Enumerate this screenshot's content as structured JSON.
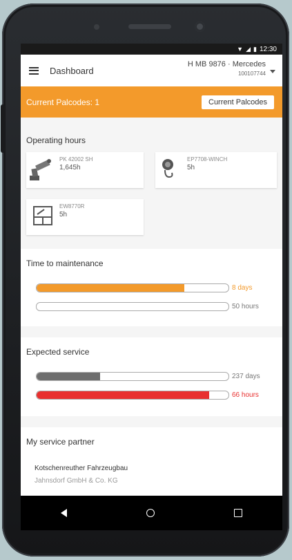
{
  "status_bar": {
    "time": "12:30"
  },
  "app_bar": {
    "title": "Dashboard",
    "vehicle_name": "H MB 9876 · Mercedes",
    "vehicle_id": "100107744"
  },
  "palcodes": {
    "label": "Current Palcodes: 1",
    "button_label": "Current Palcodes"
  },
  "operating_hours": {
    "title": "Operating hours",
    "devices": [
      {
        "name": "PK 42002 SH",
        "hours": "1,645h",
        "icon": "crane-icon"
      },
      {
        "name": "EP7708-WINCH",
        "hours": "5h",
        "icon": "winch-icon"
      },
      {
        "name": "EW8770R",
        "hours": "5h",
        "icon": "control-panel-icon"
      }
    ]
  },
  "maintenance": {
    "title": "Time to maintenance",
    "bars": [
      {
        "label": "8 days",
        "fill": 0.77,
        "color": "#f39a2b"
      },
      {
        "label": "50 hours",
        "fill": 0.0,
        "color": "#f39a2b"
      }
    ]
  },
  "expected_service": {
    "title": "Expected service",
    "bars": [
      {
        "label": "237 days",
        "fill": 0.33,
        "color": "#6e6e6e"
      },
      {
        "label": "66 hours",
        "fill": 0.9,
        "color": "#e8302f"
      }
    ]
  },
  "service_partner": {
    "title": "My service partner",
    "name": "Kotschenreuther Fahrzeugbau",
    "company": "Jahnsdorf GmbH & Co. KG"
  },
  "colors": {
    "accent": "#f39a2b",
    "danger": "#e8302f"
  }
}
